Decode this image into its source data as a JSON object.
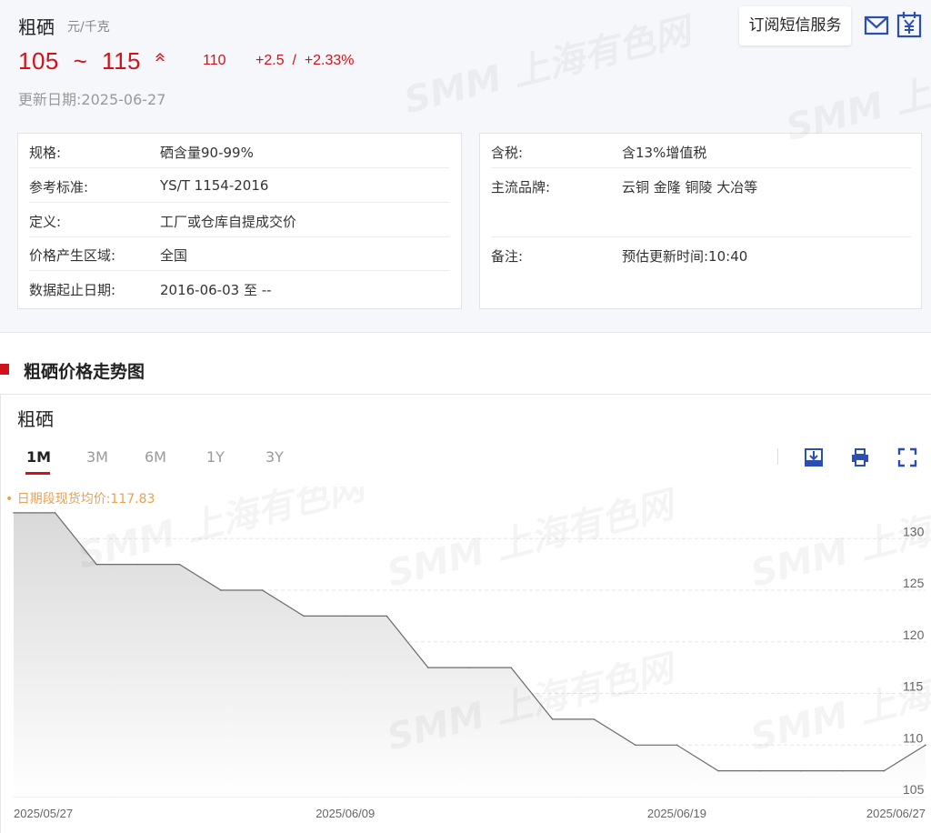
{
  "product": {
    "name": "粗硒",
    "unit": "元/千克",
    "price_low": "105",
    "price_sep": "~",
    "price_high": "115",
    "average": "110",
    "change": "+2.5  /  +2.33%",
    "update_label": "更新日期:",
    "update_date": "2025-06-27"
  },
  "actions": {
    "subscribe_label": "订阅短信服务",
    "mail_icon": "mail-icon",
    "yuan_icon": "yuan-calendar-icon"
  },
  "specs_left": [
    {
      "key": "规格:",
      "value": "硒含量90-99%"
    },
    {
      "key": "参考标准:",
      "value": "YS/T 1154-2016"
    },
    {
      "key": "定义:",
      "value": "工厂或仓库自提成交价"
    },
    {
      "key": "价格产生区域:",
      "value": "全国"
    },
    {
      "key": "数据起止日期:",
      "value": "2016-06-03 至 --"
    }
  ],
  "specs_right": [
    {
      "key": "含税:",
      "value": "含13%增值税"
    },
    {
      "key": "主流品牌:",
      "value": "云铜 金隆 铜陵 大冶等"
    },
    {
      "key": "备注:",
      "value": "预估更新时间:10:40"
    }
  ],
  "section": {
    "title": "粗硒价格走势图"
  },
  "chart_panel": {
    "name": "粗硒",
    "tabs": [
      "1M",
      "3M",
      "6M",
      "1Y",
      "3Y"
    ],
    "active_tab": "1M",
    "tools": [
      "download-icon",
      "print-icon",
      "fullscreen-icon"
    ]
  },
  "watermark": "SMM 上海有色网",
  "colors": {
    "accent": "#d0121b",
    "avg_label": "#f0a04b",
    "line": "#6b6b6b",
    "area": "#dedede"
  },
  "chart_data": {
    "type": "area",
    "title": "",
    "legend_prefix": "•",
    "avg_label": "日期段现货均价:117.83",
    "x": [
      "2025-05-27",
      "2025-05-28",
      "2025-05-29",
      "2025-05-30",
      "2025-06-03",
      "2025-06-04",
      "2025-06-05",
      "2025-06-06",
      "2025-06-09",
      "2025-06-10",
      "2025-06-11",
      "2025-06-12",
      "2025-06-13",
      "2025-06-16",
      "2025-06-17",
      "2025-06-18",
      "2025-06-19",
      "2025-06-20",
      "2025-06-23",
      "2025-06-24",
      "2025-06-25",
      "2025-06-26",
      "2025-06-27"
    ],
    "y": [
      132.5,
      132.5,
      127.5,
      127.5,
      127.5,
      125,
      125,
      122.5,
      122.5,
      122.5,
      117.5,
      117.5,
      117.5,
      112.5,
      112.5,
      110,
      110,
      107.5,
      107.5,
      107.5,
      107.5,
      107.5,
      110
    ],
    "x_tick_labels": [
      "2025/05/27",
      "2025/06/09",
      "2025/06/19",
      "2025/06/27"
    ],
    "x_tick_index": [
      0,
      8,
      16,
      22
    ],
    "y_ticks": [
      105,
      110,
      115,
      120,
      125,
      130
    ],
    "ylim": [
      105,
      132.5
    ],
    "grid": true
  }
}
